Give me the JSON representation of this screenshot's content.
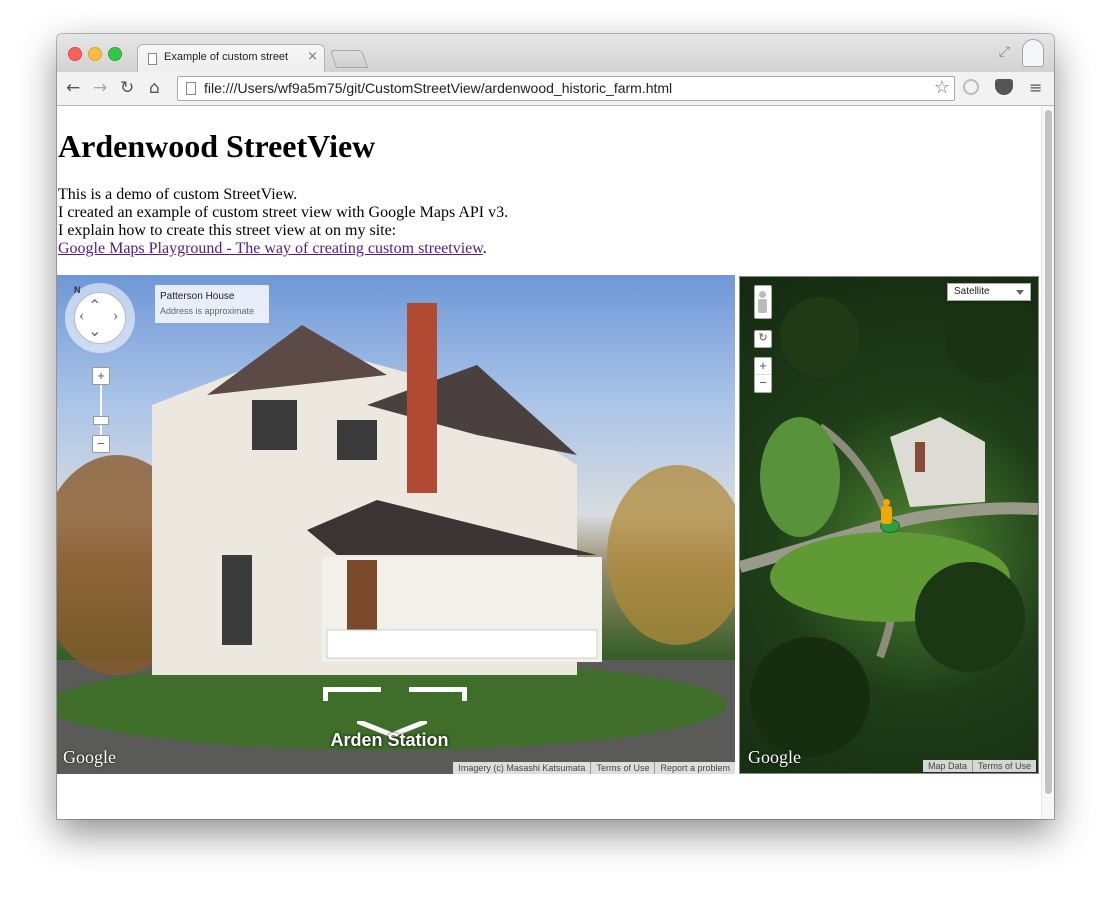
{
  "browser": {
    "tab_title": "Example of custom street",
    "tab_close": "×",
    "url": "file:///Users/wf9a5m75/git/CustomStreetView/ardenwood_historic_farm.html",
    "nav": {
      "back": "←",
      "forward": "→",
      "reload": "↻",
      "home": "⌂"
    },
    "star": "☆",
    "menu": "≡",
    "fullscreen": "⤢"
  },
  "page": {
    "heading": "Ardenwood StreetView",
    "lines": [
      "This is a demo of custom StreetView.",
      "I created an example of custom street view with Google Maps API v3.",
      "I explain how to create this street view at on my site:"
    ],
    "link_text": "Google Maps Playground - The way of creating custom streetview",
    "link_suffix": "."
  },
  "streetview": {
    "compass_letter": "N",
    "zoom_in": "+",
    "zoom_out": "−",
    "address_title": "Patterson House",
    "address_sub": "Address is approximate",
    "link_label": "Arden Station",
    "logo": "Google",
    "attribution": [
      "Imagery (c) Masashi Katsumata",
      "Terms of Use",
      "Report a problem"
    ]
  },
  "map": {
    "map_type": "Satellite",
    "zoom_in": "+",
    "zoom_out": "−",
    "logo": "Google",
    "attribution": [
      "Map Data",
      "Terms of Use"
    ]
  }
}
